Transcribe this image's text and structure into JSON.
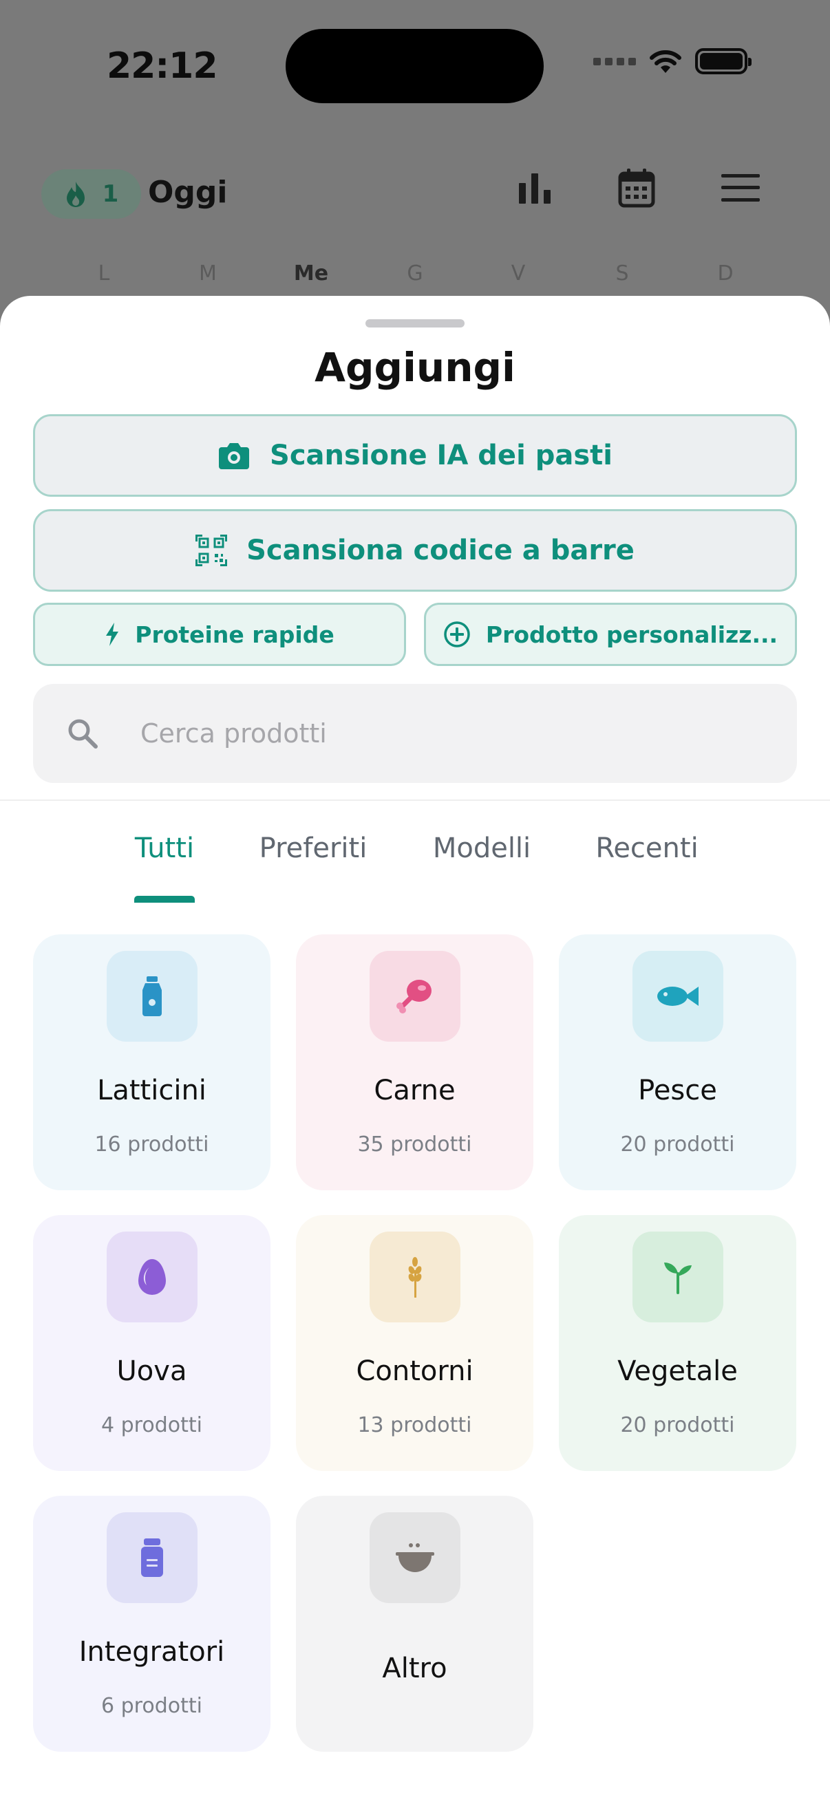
{
  "status_bar": {
    "time": "22:12"
  },
  "header": {
    "streak_count": "1",
    "title": "Oggi",
    "icons": [
      "bar-chart-icon",
      "calendar-icon",
      "hamburger-menu-icon"
    ]
  },
  "week_days": [
    "L",
    "M",
    "Me",
    "G",
    "V",
    "S",
    "D"
  ],
  "active_day": "Me",
  "sheet": {
    "title": "Aggiungi",
    "ai_scan_label": "Scansione IA dei pasti",
    "barcode_label": "Scansiona codice a barre",
    "quick_protein_label": "Proteine rapide",
    "custom_product_label": "Prodotto personalizz...",
    "search_placeholder": "Cerca prodotti",
    "tabs": [
      "Tutti",
      "Preferiti",
      "Modelli",
      "Recenti"
    ],
    "active_tab": "Tutti",
    "categories": [
      {
        "name": "Latticini",
        "count": "16 prodotti",
        "icon": "milk-bottle-icon",
        "bg": "#eff7fb",
        "icon_bg": "#d9edf7",
        "accent": "#2a93c6"
      },
      {
        "name": "Carne",
        "count": "35 prodotti",
        "icon": "meat-drumstick-icon",
        "bg": "#fcf1f4",
        "icon_bg": "#f8dbe4",
        "accent": "#e24f83"
      },
      {
        "name": "Pesce",
        "count": "20 prodotti",
        "icon": "fish-icon",
        "bg": "#eef7fa",
        "icon_bg": "#d6eef4",
        "accent": "#1fa3bd"
      },
      {
        "name": "Uova",
        "count": "4 prodotti",
        "icon": "egg-icon",
        "bg": "#f5f3fd",
        "icon_bg": "#e6ddf7",
        "accent": "#8c5dd6"
      },
      {
        "name": "Contorni",
        "count": "13 prodotti",
        "icon": "wheat-icon",
        "bg": "#fcf9f2",
        "icon_bg": "#f6ead3",
        "accent": "#d6a341"
      },
      {
        "name": "Vegetale",
        "count": "20 prodotti",
        "icon": "sprout-icon",
        "bg": "#eef7f1",
        "icon_bg": "#d7eedd",
        "accent": "#35a85a"
      },
      {
        "name": "Integratori",
        "count": "6 prodotti",
        "icon": "supplement-jar-icon",
        "bg": "#f3f3fd",
        "icon_bg": "#e0e0f7",
        "accent": "#6e6ddd"
      },
      {
        "name": "Altro",
        "count": "",
        "icon": "bowl-icon",
        "bg": "#f3f3f4",
        "icon_bg": "#e4e4e5",
        "accent": "#7d7671"
      }
    ]
  },
  "colors": {
    "accent": "#0e8f7c",
    "overlay": "#7a7a7a"
  }
}
